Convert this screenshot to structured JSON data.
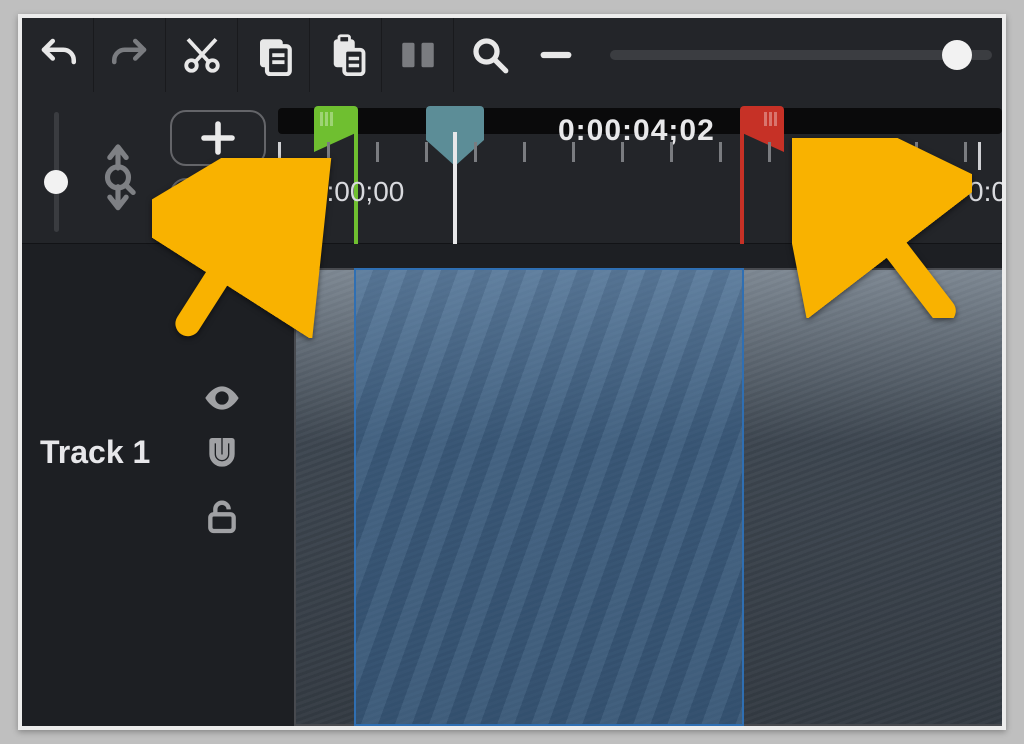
{
  "toolbar": {
    "undo": "undo",
    "redo": "redo",
    "cut": "cut",
    "copy": "copy",
    "paste": "paste",
    "split": "split",
    "zoom": "zoom",
    "zoom_out_minus": "−"
  },
  "timeline": {
    "display_time": "0:00:04;02",
    "tick_zero_label": "0:00:00;00",
    "tick_next_label": "0:0",
    "in_marker_color": "#6fbf30",
    "out_marker_color": "#c63126",
    "playhead_color": "#5c8d97"
  },
  "track": {
    "label": "Track 1"
  },
  "controls": {
    "add_track": "add",
    "expand_track": "expand",
    "eye": "visibility",
    "magnet": "snap",
    "lock": "lock"
  }
}
